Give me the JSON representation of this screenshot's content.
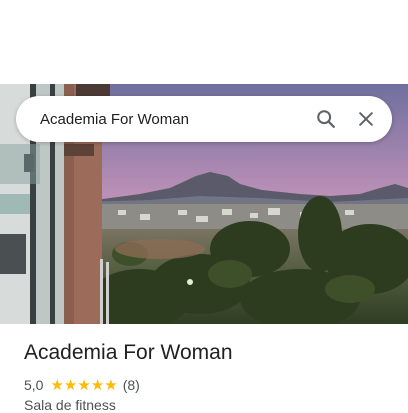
{
  "search": {
    "query": "Academia For Woman",
    "search_icon": "search-icon",
    "close_icon": "close-icon"
  },
  "place": {
    "name": "Academia For Woman",
    "rating": "5,0",
    "stars": 5,
    "review_count": "(8)",
    "category": "Sala de fitness"
  },
  "colors": {
    "star": "#fbbc04",
    "text": "#202124",
    "secondary": "#4d5156"
  }
}
